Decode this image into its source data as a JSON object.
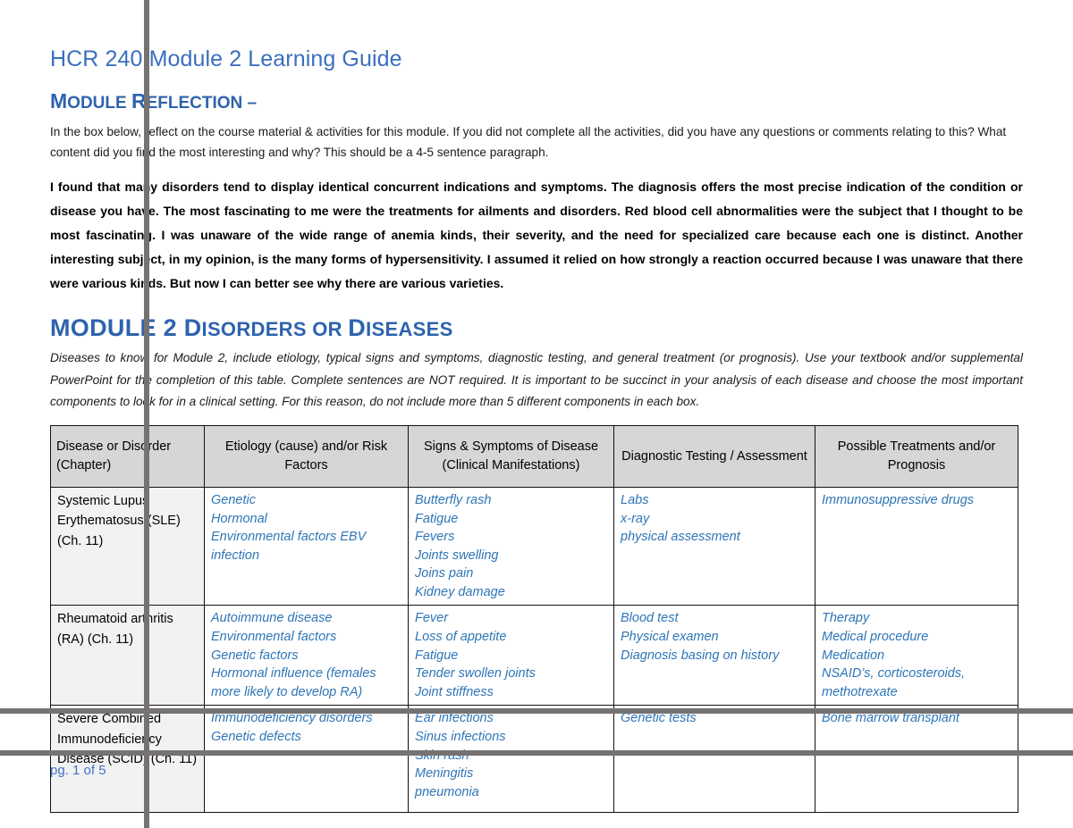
{
  "document": {
    "title": "HCR 240 Module 2 Learning Guide",
    "footer_page": "pg. 1 of 5"
  },
  "reflection_section": {
    "heading_big": "M",
    "heading_rest1": "ODULE ",
    "heading_big2": "R",
    "heading_rest2": "EFLECTION –",
    "heading_full": "MODULE REFLECTION –",
    "instructions": "In the box below, reflect on the course material & activities for this module.  If you did not complete all the activities, did you have any questions or comments relating to this?  What content did you find the most interesting and why?  This should be a 4-5 sentence paragraph.",
    "student_response": "I found that many disorders tend to display identical concurrent indications and symptoms. The diagnosis offers the most precise indication of the condition or disease you have. The most fascinating to me were the treatments for ailments and disorders. Red blood cell abnormalities were the subject that I thought to be most fascinating. I was unaware of the wide range of anemia kinds, their severity, and the need for specialized care because each one is distinct. Another interesting subject, in my opinion, is the many forms of hypersensitivity. I assumed it relied on how strongly a reaction occurred because I was unaware that there were various kinds. But now I can better see why there are various varieties."
  },
  "disorders_section": {
    "heading_full": "MODULE 2 DISORDERS OR DISEASES",
    "heading_part_a": "MODULE 2 ",
    "heading_part_b": "D",
    "heading_part_c": "ISORDERS OR ",
    "heading_part_d": "D",
    "heading_part_e": "ISEASES",
    "intro": "Diseases to know for Module 2, include etiology, typical signs and symptoms, diagnostic testing, and general treatment (or prognosis).  Use your textbook and/or supplemental PowerPoint for the completion of this table.  Complete sentences are NOT required.   It is important to be succinct in your analysis of each disease and choose the most important components to look for in a clinical setting. For this reason, do not include more than 5 different components in each box."
  },
  "table": {
    "columns": [
      "Disease or Disorder (Chapter)",
      "Etiology (cause) and/or Risk Factors",
      "Signs & Symptoms of Disease (Clinical Manifestations)",
      "Diagnostic Testing / Assessment",
      "Possible Treatments and/or Prognosis"
    ],
    "rows": [
      {
        "name": "Systemic Lupus Erythematosus (SLE) (Ch. 11)",
        "etiology": "Genetic\nHormonal\nEnvironmental factors EBV\ninfection",
        "signs": "Butterfly rash\nFatigue\nFevers\nJoints swelling\nJoins pain\nKidney damage",
        "diagnostic": "Labs\nx-ray\nphysical assessment",
        "treatment": "Immunosuppressive drugs"
      },
      {
        "name": "Rheumatoid arthritis (RA) (Ch. 11)",
        "etiology": "Autoimmune disease\nEnvironmental factors\nGenetic factors\nHormonal influence (females\nmore likely to develop RA)",
        "signs": "Fever\nLoss of appetite\nFatigue\nTender swollen joints\nJoint stiffness",
        "diagnostic": "Blood test\nPhysical examen\nDiagnosis basing on history",
        "treatment": "Therapy\nMedical procedure\nMedication\nNSAID’s, corticosteroids,\nmethotrexate"
      },
      {
        "name": "Severe Combined Immunodeficiency Disease (SCID) (Ch. 11)",
        "etiology": "Immunodeficiency disorders\nGenetic defects",
        "signs": "Ear infections\nSinus infections\nSkin rash\nMeningitis\npneumonia",
        "diagnostic": "Genetic tests",
        "treatment": "Bone marrow transplant"
      }
    ]
  },
  "colors": {
    "heading_blue": "#3B6FBE",
    "smallcaps_blue": "#2E63AE",
    "cell_text_blue": "#2E75B6",
    "header_row_gray": "#D6D6D6",
    "name_cell_gray": "#F2F2F2",
    "overlay_line_gray": "#767272",
    "footer_blue": "#4472C4"
  }
}
